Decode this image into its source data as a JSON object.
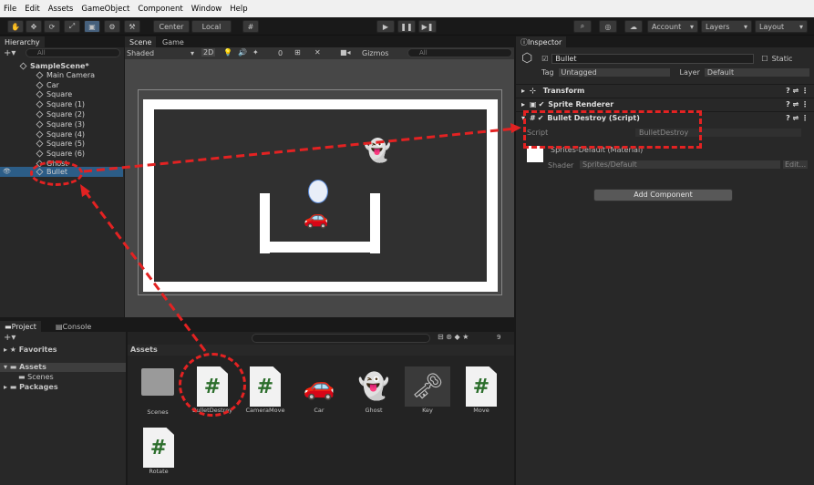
{
  "menu": [
    "File",
    "Edit",
    "Assets",
    "GameObject",
    "Component",
    "Window",
    "Help"
  ],
  "toolbar": {
    "center": "Center",
    "local": "Local",
    "account": "Account",
    "layers": "Layers",
    "layout": "Layout"
  },
  "hierarchy": {
    "tab": "Hierarchy",
    "search_placeholder": "All",
    "scene": "SampleScene*",
    "items": [
      "Main Camera",
      "Car",
      "Square",
      "Square (1)",
      "Square (2)",
      "Square (3)",
      "Square (4)",
      "Square (5)",
      "Square (6)",
      "Ghost",
      "Bullet"
    ]
  },
  "scene": {
    "tab_scene": "Scene",
    "tab_game": "Game",
    "shading": "Shaded",
    "mode2d": "2D",
    "gizmos": "Gizmos",
    "search_placeholder": "All",
    "gizmo_count": "0"
  },
  "inspector": {
    "tab": "Inspector",
    "object_name": "Bullet",
    "static_label": "Static",
    "tag_label": "Tag",
    "tag_value": "Untagged",
    "layer_label": "Layer",
    "layer_value": "Default",
    "components": [
      "Transform",
      "Sprite Renderer",
      "Bullet Destroy (Script)"
    ],
    "script_label": "Script",
    "script_value": "BulletDestroy",
    "material_name": "Sprites-Default (Material)",
    "shader_label": "Shader",
    "shader_value": "Sprites/Default",
    "edit_label": "Edit...",
    "add_component": "Add Component"
  },
  "project": {
    "tab_project": "Project",
    "tab_console": "Console",
    "favorites": "Favorites",
    "assets": "Assets",
    "scenes": "Scenes",
    "packages": "Packages",
    "breadcrumb": "Assets",
    "count": "9",
    "items": [
      "Scenes",
      "BulletDestroy",
      "CameraMove",
      "Car",
      "Ghost",
      "Key",
      "Move",
      "Rotate"
    ]
  },
  "colors": {
    "accent": "#2c5d87",
    "annotation": "#e32222"
  }
}
